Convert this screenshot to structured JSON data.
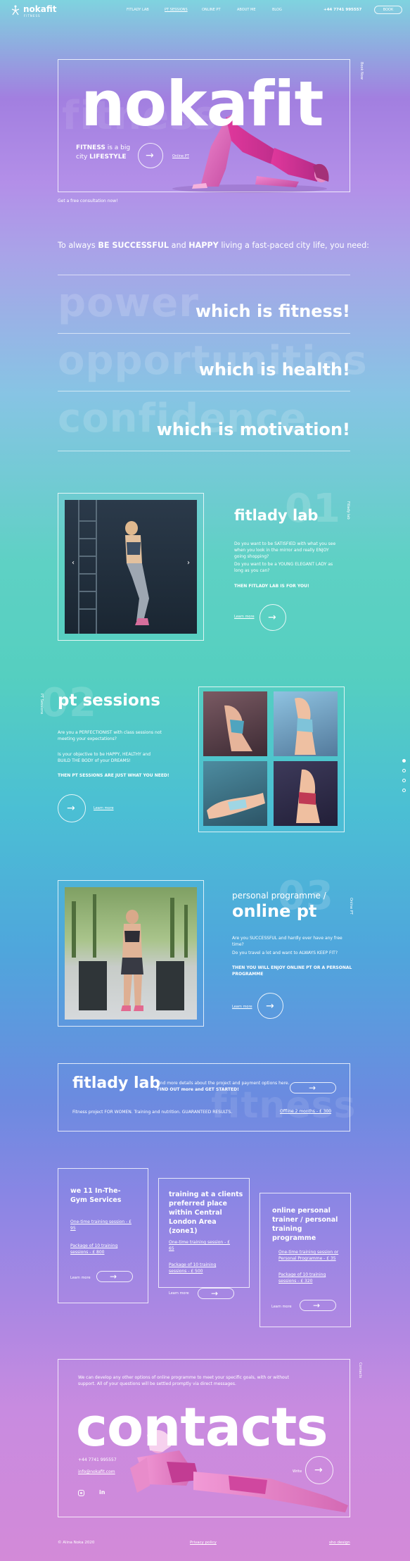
{
  "header": {
    "logo_name": "nokafit",
    "logo_sub": "FITNESS",
    "nav": [
      "FITLADY LAB",
      "PT SESSIONS",
      "ONLINE PT",
      "ABOUT ME",
      "BLOG"
    ],
    "phone": "+44 7741 995557",
    "book_label": "BOOK"
  },
  "hero": {
    "title": "nokafit",
    "ghost": "fitness",
    "tagline_1": "FITNESS",
    "tagline_2": " is a big",
    "tagline_3": "city ",
    "tagline_4": "LIFESTYLE",
    "online_pt_link": "Online PT",
    "consult": "Get a free consultation now!",
    "side": "Book Now"
  },
  "intro": {
    "part1": "To always ",
    "bold1": "BE SUCCESSFUL",
    "part2": " and ",
    "bold2": "HAPPY",
    "part3": " living a fast-paced city life, you need:"
  },
  "needs": [
    {
      "ghost": "power",
      "text": "which is fitness!"
    },
    {
      "ghost": "opportunities",
      "text": "which is health!"
    },
    {
      "ghost": "confidence",
      "text": "which is motivation!"
    }
  ],
  "fitlady": {
    "num": "01",
    "title": "fitlady lab",
    "side": "Fitlady lab",
    "p1": "Do you want to be SATISFIED with what you see when you look in the mirror and really ENJOY going shopping?",
    "p2": "Do you want to be a YOUNG ELEGANT LADY as long as you can?",
    "p3": "THEN FITLADY LAB IS FOR YOU!",
    "more": "Learn more"
  },
  "pt": {
    "num": "02",
    "title": "pt sessions",
    "side": "PT Sessions",
    "p1": "Are you a PERFECTIONIST with class sessions not meeting your expectations?",
    "p2": "Is your objective to be HAPPY, HEALTHY and BUILD THE BODY of your DREAMS!",
    "p3": "THEN PT SESSIONS ARE JUST WHAT YOU NEED!",
    "more": "Learn more"
  },
  "online": {
    "num": "03",
    "kicker": "personal programme /",
    "title": "online pt",
    "side": "Online PT",
    "p1": "Are you SUCCESSFUL and hardly ever have any free time?",
    "p2": "Do you travel a lot and want to ALWAYS KEEP FIT?",
    "p3": "THEN YOU WILL ENJOY ONLINE PT OR A PERSONAL PROGRAMME",
    "more": "Learn more"
  },
  "fitlady_offer": {
    "title": "fitlady lab",
    "ghost": "fitness",
    "desc": "Find more details about the project and payment options here.",
    "desc_bold": "FIND OUT more and GET STARTED!",
    "note": "Fitness project FOR WOMEN. Training and nutrition. GUARANTEED RESULTS.",
    "price": "Offline 2 months - £ 300"
  },
  "pricing": [
    {
      "title": "we 11 In-The-Gym Services",
      "items": [
        "One-time training session - £ 95",
        "Package of 10 training sessions - £ 800"
      ],
      "more": "Learn more"
    },
    {
      "title": "training at a clients preferred place within Central London Area (zone1)",
      "items": [
        "One-time training session - £ 65",
        "Package of 10 training sessions - £ 500"
      ],
      "more": "Learn more"
    },
    {
      "title": "online personal trainer / personal training programme",
      "items": [
        "One-time training session or Personal Programme - £ 35",
        "Package of 10 training sessions - £ 320"
      ],
      "more": "Learn more"
    }
  ],
  "contacts": {
    "intro": "We can develop any other options of online programme to meet your specific goals, with or without support. All of your questions will be settled promptly via direct messages.",
    "title": "contacts",
    "phone": "+44 7741 995557",
    "email": "info@nokafit.com",
    "side": "Contacts",
    "write": "Write"
  },
  "footer": {
    "copy": "© Alina Noka 2020",
    "privacy": "Privacy policy",
    "credit": "sho design"
  }
}
